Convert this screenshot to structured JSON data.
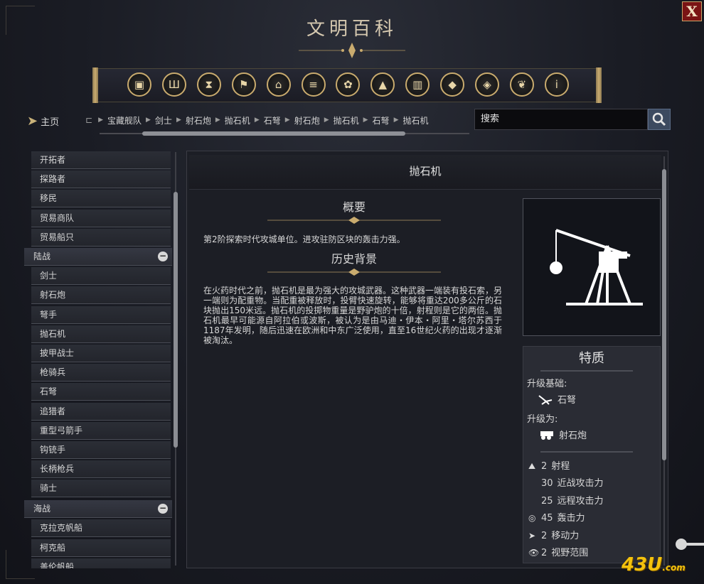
{
  "window": {
    "title": "文明百科",
    "close_label": "X"
  },
  "categories": [
    {
      "icon": "units-cube-icon",
      "glyph": "▣"
    },
    {
      "icon": "drink-cup-icon",
      "glyph": "Ш"
    },
    {
      "icon": "hourglass-icon",
      "glyph": "⧗"
    },
    {
      "icon": "flag-icon",
      "glyph": "⚑"
    },
    {
      "icon": "building-columns-icon",
      "glyph": "⌂"
    },
    {
      "icon": "open-book-icon",
      "glyph": "≡"
    },
    {
      "icon": "flower-icon",
      "glyph": "✿"
    },
    {
      "icon": "mountain-icon",
      "glyph": "▲"
    },
    {
      "icon": "wonder-building-icon",
      "glyph": "▥"
    },
    {
      "icon": "diamond-arrow-icon",
      "glyph": "◆"
    },
    {
      "icon": "leaf-diamond-icon",
      "glyph": "◈"
    },
    {
      "icon": "dove-icon",
      "glyph": "❦"
    },
    {
      "icon": "info-icon",
      "glyph": "i"
    }
  ],
  "nav": {
    "home_label": "主页",
    "breadcrumb_lead": "⊏",
    "breadcrumbs": [
      "宝藏舰队",
      "剑士",
      "射石炮",
      "抛石机",
      "石弩",
      "射石炮",
      "抛石机",
      "石弩",
      "抛石机"
    ]
  },
  "search": {
    "placeholder": "搜索"
  },
  "sidebar": {
    "items_before": [
      "开拓者",
      "探路者",
      "移民",
      "贸易商队",
      "贸易船只"
    ],
    "group_land": "陆战",
    "land_items": [
      "剑士",
      "射石炮",
      "弩手",
      "抛石机",
      "披甲战士",
      "枪骑兵",
      "石弩",
      "追猎者",
      "重型弓箭手",
      "钩铳手",
      "长柄枪兵",
      "骑士"
    ],
    "group_naval": "海战",
    "naval_items": [
      "克拉克帆船",
      "柯克船",
      "盖伦帆船"
    ],
    "collapse_glyph": "−"
  },
  "article": {
    "title": "抛石机",
    "summary_heading": "概要",
    "summary_text": "第2阶探索时代攻城单位。进攻驻防区块的轰击力强。",
    "history_heading": "历史背景",
    "history_text": "在火药时代之前，抛石机是最为强大的攻城武器。这种武器一端装有投石索，另一端则为配重物。当配重被释放时，投臂快速旋转，能够将重达200多公斤的石块抛出150米远。抛石机的投掷物重量是野驴炮的十倍，射程则是它的两倍。抛石机最早可能源自阿拉伯或波斯，被认为是由马迪・伊本・阿里・塔尔苏西于1187年发明，随后迅速在欧洲和中东广泛使用，直至16世纪火药的出现才逐渐被淘汰。"
  },
  "traits": {
    "heading": "特质",
    "upgrade_from_label": "升级基础:",
    "upgrade_from_unit": "石弩",
    "upgrade_to_label": "升级为:",
    "upgrade_to_unit": "射石炮",
    "stats": [
      {
        "icon": "range-icon",
        "value": "2",
        "label": "射程"
      },
      {
        "icon": "",
        "value": "30",
        "label": "近战攻击力"
      },
      {
        "icon": "",
        "value": "25",
        "label": "远程攻击力"
      },
      {
        "icon": "bombard-icon",
        "value": "45",
        "label": "轰击力"
      },
      {
        "icon": "movement-arrow-icon",
        "value": "2",
        "label": "移动力"
      },
      {
        "icon": "eye-icon",
        "value": "2",
        "label": "视野范围"
      }
    ]
  },
  "watermark": {
    "main": "43U",
    "suffix": ".com"
  },
  "colors": {
    "accent_gold": "#c9ab6e",
    "close_red": "#7a1414",
    "background": "#1a1c24"
  }
}
